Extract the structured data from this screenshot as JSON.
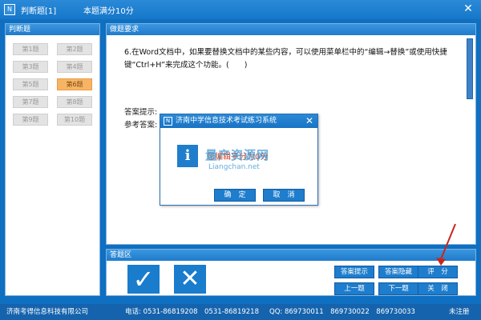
{
  "window": {
    "title": "判断题[1]",
    "score_info": "本题满分10分",
    "icon_text": "N",
    "close": "✕"
  },
  "left_panel": {
    "header": "判断题",
    "questions": [
      "第1题",
      "第2题",
      "第3题",
      "第4题",
      "第5题",
      "第6题",
      "第7题",
      "第8题",
      "第9题",
      "第10题"
    ],
    "active_question": "第6题"
  },
  "question_panel": {
    "header": "做题要求",
    "text": "6.在Word文档中，如果要替换文档中的某些内容，可以使用菜单栏中的“编辑→替换”或使用快捷键“Ctrl+H”来完成这个功能。(　　)",
    "hint_label": "答案提示:",
    "ref_answer_label": "参考答案:"
  },
  "answer_panel": {
    "header": "答题区",
    "true_symbol": "✓",
    "false_symbol": "✕",
    "buttons": {
      "hint": "答案提示",
      "hide": "答案隐藏",
      "score": "评　分",
      "prev": "上一题",
      "next": "下一题",
      "close": "关　闭"
    }
  },
  "modal": {
    "title": "济南中学信息技术考试练习系统",
    "close": "✕",
    "icon": "i",
    "icon_badge": "N",
    "message": "您编辑平分为0分",
    "ok": "确　定",
    "cancel": "取　消"
  },
  "watermark": {
    "text": "量产资源网",
    "url": "Liangchan.net"
  },
  "statusbar": {
    "company": "济南考得信息科技有限公司",
    "phone": "电话: 0531-86819208　0531-86819218",
    "qq": "QQ: 869730011　869730022　869730033",
    "status": "未注册"
  },
  "colors": {
    "brand_blue": "#1a7ccc",
    "active_question": "#f7b465",
    "message_red": "#d23c1a",
    "arrow_red": "#c8261c"
  }
}
